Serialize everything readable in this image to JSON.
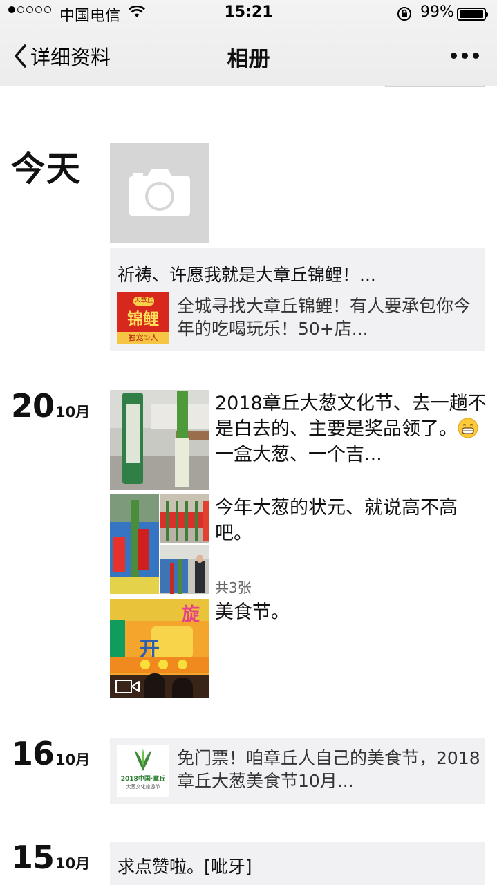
{
  "status_bar": {
    "carrier": "中国电信",
    "time": "15:21",
    "battery": "99%",
    "signal_bars_filled": 1,
    "signal_bars_total": 5
  },
  "nav": {
    "back_label": "详细资料",
    "title": "相册"
  },
  "timeline": {
    "today_label": "今天",
    "today_share": {
      "caption": "祈祷、许愿我就是大章丘锦鲤！...",
      "thumb_text_top": "大章丘",
      "thumb_text_main": "锦鲤",
      "thumb_text_bottom": "独宠①人",
      "link_text": "全城寻找大章丘锦鲤！有人要承包你今年的吃喝玩乐！50+店..."
    },
    "day20": {
      "day": "20",
      "month": "10月",
      "post1_text_before_emoji": "2018章丘大葱文化节、去一趟不是白去的、主要是奖品领了。",
      "post1_text_after_emoji": "一盒大葱、一个吉...",
      "post2_text": "今年大葱的状元、就说高不高吧。",
      "post2_count": "共3张",
      "post3_text": "美食节。",
      "poster_char_kai": "开",
      "poster_char_side": "旋"
    },
    "day16": {
      "day": "16",
      "month": "10月",
      "thumb_logo_text": "2018中国·章丘",
      "thumb_sub_text": "大葱文化旅游节",
      "link_text": "免门票！咱章丘人自己的美食节，2018章丘大葱美食节10月..."
    },
    "day15": {
      "day": "15",
      "month": "10月",
      "caption": "求点赞啦。[呲牙]"
    }
  },
  "colors": {
    "card_bg": "#f1f1f3",
    "header_bg": "#efefef",
    "camera_tile_bg": "#d6d6d6",
    "koi_red": "#d8271c",
    "onion_green": "#3f8a3a"
  }
}
